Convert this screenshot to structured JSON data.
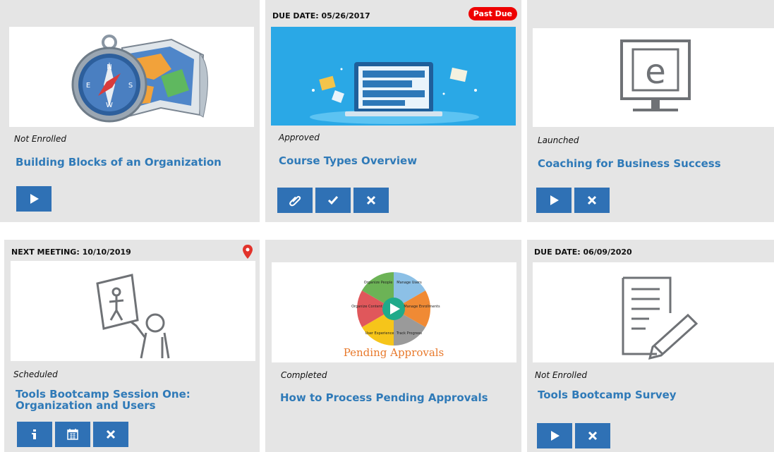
{
  "colors": {
    "card_bg": "#e5e5e5",
    "title": "#2f7ab8",
    "button": "#2f71b5",
    "badge": "#ee0000"
  },
  "cards": [
    {
      "header": "",
      "status": "Not Enrolled",
      "title": "Building Blocks of an Organization",
      "thumbnail": "compass-map-illustration",
      "buttons": [
        "play-icon"
      ]
    },
    {
      "header": "DUE DATE: 05/26/2017",
      "badge": "Past Due",
      "status": "Approved",
      "title": "Course Types Overview",
      "thumbnail": "laptop-books-illustration",
      "buttons": [
        "paperclip-icon",
        "check-icon",
        "close-icon"
      ]
    },
    {
      "header": "",
      "status": "Launched",
      "title": "Coaching for Business Success",
      "thumbnail": "e-learning-monitor-icon",
      "buttons": [
        "play-icon",
        "close-icon"
      ]
    },
    {
      "header": "NEXT MEETING: 10/10/2019",
      "status": "Scheduled",
      "title": "Tools Bootcamp Session One: Organization and Users",
      "thumbnail": "instructor-board-icon",
      "buttons": [
        "info-icon",
        "calendar-icon",
        "close-icon"
      ]
    },
    {
      "header": "",
      "status": "Completed",
      "title": "How to Process Pending Approvals",
      "thumbnail": "pending-approvals-wheel",
      "thumbnail_text": {
        "caption": "Pending Approvals",
        "segments": [
          "Manage Users",
          "Manage Enrollments",
          "Track Progress",
          "User Experience",
          "Organize Content",
          "Organize People"
        ]
      },
      "buttons": []
    },
    {
      "header": "DUE DATE: 06/09/2020",
      "status": "Not Enrolled",
      "title": "Tools Bootcamp Survey",
      "thumbnail": "survey-document-icon",
      "buttons": [
        "play-icon",
        "close-icon"
      ]
    }
  ]
}
